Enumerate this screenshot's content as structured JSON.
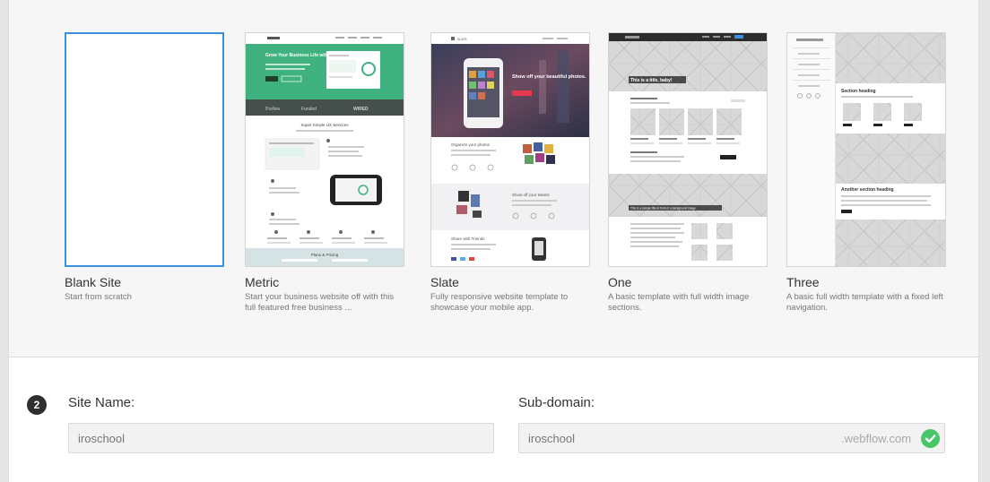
{
  "templates": [
    {
      "id": "blank",
      "title": "Blank Site",
      "desc": "Start from scratch",
      "selected": true
    },
    {
      "id": "metric",
      "title": "Metric",
      "desc": "Start your business website off with this full featured free business ..."
    },
    {
      "id": "slate",
      "title": "Slate",
      "desc": "Fully responsive website template to showcase your mobile app."
    },
    {
      "id": "one",
      "title": "One",
      "desc": "A basic template with full width image sections."
    },
    {
      "id": "three",
      "title": "Three",
      "desc": "A basic full width template with a fixed left navigation."
    }
  ],
  "thumbs": {
    "metric": {
      "hero_text": "Grow Your Business Life with Metric",
      "logos": [
        "Forbes",
        "Funded",
        "WIRED"
      ],
      "section_title": "Super Simple UX Services",
      "footer_title": "Plans & Pricing"
    },
    "slate": {
      "brand": "SLATE",
      "hero_text": "Show off your beautiful photos.",
      "section1": "Organize your photos",
      "section2": "Show off your tweets",
      "section3": "Share with Friends"
    },
    "one": {
      "hero_text": "This is a title, baby!",
      "mid_text": "This is a sample title in front of a background image"
    },
    "three": {
      "heading1": "Section heading",
      "heading2": "Another section heading"
    }
  },
  "form": {
    "step": "2",
    "site_name_label": "Site Name:",
    "site_name_value": "iroschool",
    "subdomain_label": "Sub-domain:",
    "subdomain_value": "iroschool",
    "subdomain_suffix": ".webflow.com",
    "valid_color": "#48c768"
  }
}
